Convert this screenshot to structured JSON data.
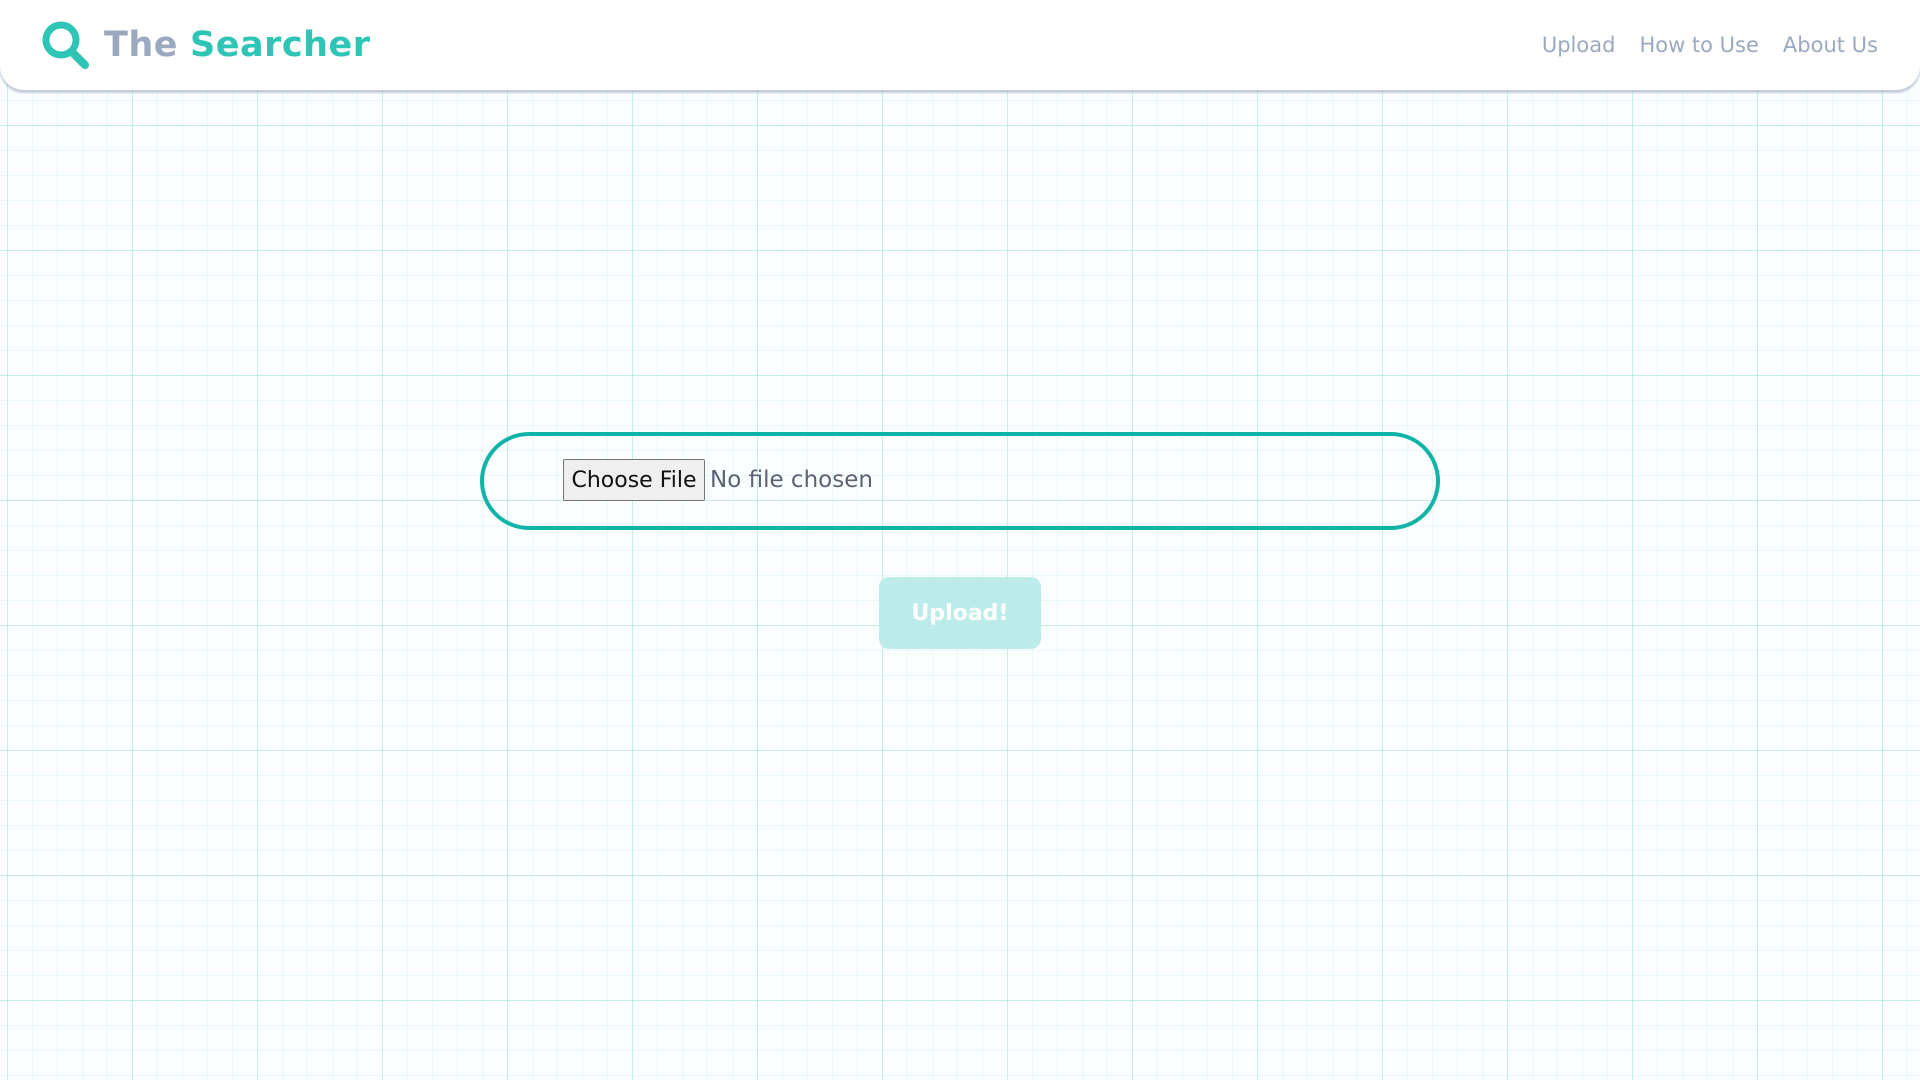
{
  "brand": {
    "part1": "The",
    "part2": "Searcher",
    "icon": "search-icon"
  },
  "nav": {
    "items": [
      {
        "label": "Upload"
      },
      {
        "label": "How to Use"
      },
      {
        "label": "About Us"
      }
    ]
  },
  "upload_form": {
    "choose_file_label": "Choose File",
    "file_status": "No file chosen",
    "submit_label": "Upload!"
  },
  "colors": {
    "accent": "#2ec4b6",
    "accent_border": "#10b4a7",
    "muted_text": "#9aa8c0",
    "button_disabled_bg": "#bcecea"
  }
}
